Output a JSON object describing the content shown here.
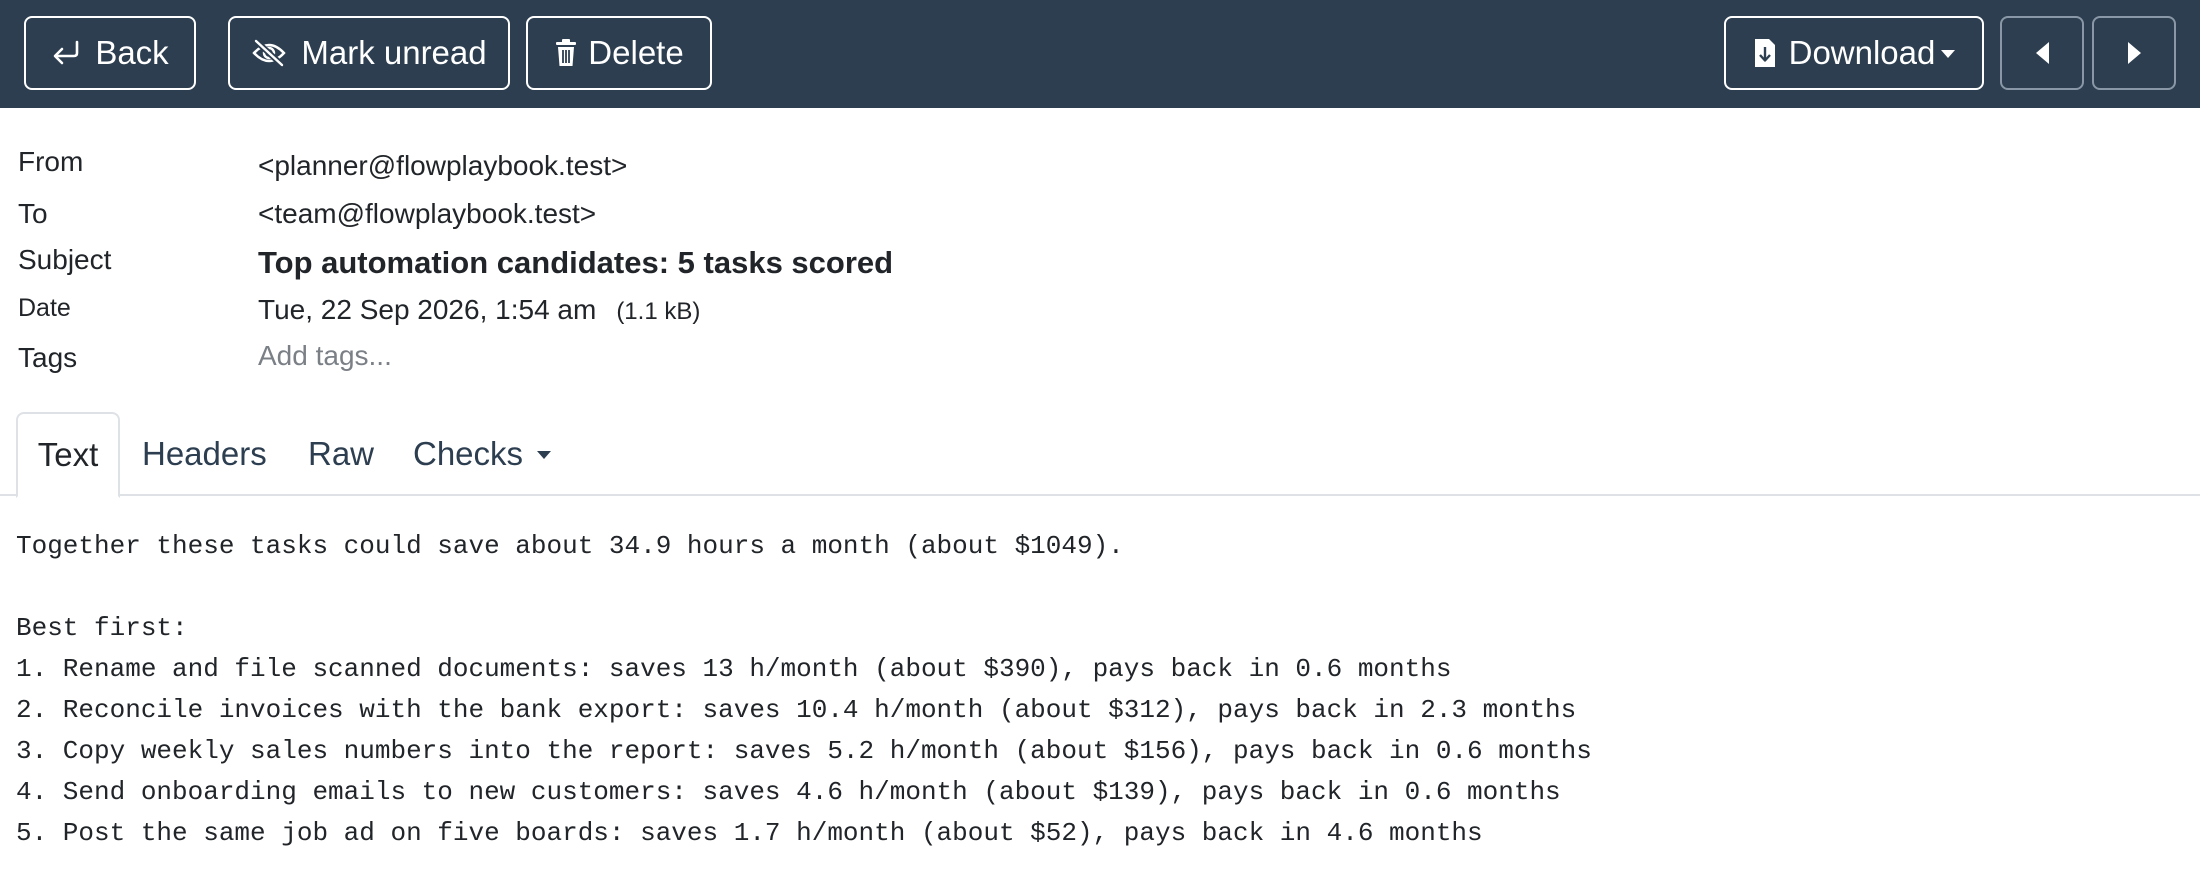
{
  "toolbar": {
    "back_label": "Back",
    "mark_unread_label": "Mark unread",
    "delete_label": "Delete",
    "download_label": "Download"
  },
  "headers": {
    "from_label": "From",
    "from_value": "<planner@flowplaybook.test>",
    "to_label": "To",
    "to_value": "<team@flowplaybook.test>",
    "subject_label": "Subject",
    "subject_value": "Top automation candidates: 5 tasks scored",
    "date_label": "Date",
    "date_value": "Tue, 22 Sep 2026, 1:54 am",
    "size_value": "(1.1 kB)",
    "tags_label": "Tags",
    "tags_placeholder": "Add tags..."
  },
  "tabs": [
    {
      "label": "Text",
      "active": true
    },
    {
      "label": "Headers",
      "active": false
    },
    {
      "label": "Raw",
      "active": false
    },
    {
      "label": "Checks",
      "active": false
    }
  ],
  "body": {
    "summary": "Together these tasks could save about 34.9 hours a month (about $1049).",
    "list_heading": "Best first:",
    "items": [
      "1. Rename and file scanned documents: saves 13 h/month (about $390), pays back in 0.6 months",
      "2. Reconcile invoices with the bank export: saves 10.4 h/month (about $312), pays back in 2.3 months",
      "3. Copy weekly sales numbers into the report: saves 5.2 h/month (about $156), pays back in 0.6 months",
      "4. Send onboarding emails to new customers: saves 4.6 h/month (about $139), pays back in 0.6 months",
      "5. Post the same job ad on five boards: saves 1.7 h/month (about $52), pays back in 4.6 months"
    ]
  },
  "colors": {
    "toolbar_bg": "#2c3e50",
    "text": "#212529",
    "placeholder": "#7b8087",
    "tab_border": "#dee2e6"
  },
  "icons": {
    "back": "return-arrow-icon",
    "mark_unread": "eye-slash-icon",
    "delete": "trash-icon",
    "download": "file-download-icon",
    "prev": "caret-left-icon",
    "next": "caret-right-icon",
    "dropdown": "caret-down-icon"
  }
}
